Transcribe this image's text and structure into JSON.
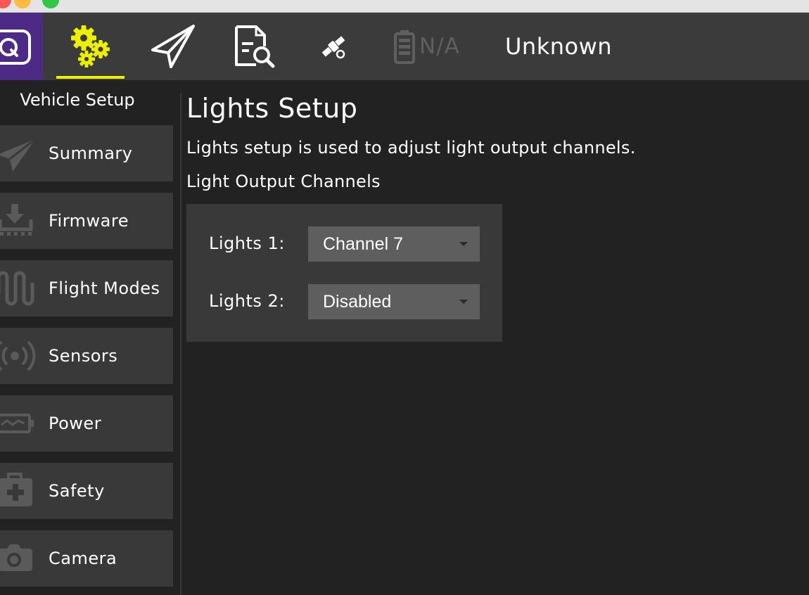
{
  "toolbar": {
    "battery_text": "N/A",
    "vehicle_status": "Unknown",
    "active_color": "#ecf000",
    "brand_color": "#4c2a86"
  },
  "icons": {
    "app_logo": "qgc-logo-icon",
    "vehicle_setup": "gears-icon",
    "plan": "paper-plane-icon",
    "analyze": "document-search-icon",
    "gps": "satellite-icon",
    "battery": "battery-icon"
  },
  "sidebar": {
    "header": "Vehicle Setup",
    "items": [
      {
        "label": "Summary",
        "icon": "paper-plane-icon"
      },
      {
        "label": "Firmware",
        "icon": "download-icon"
      },
      {
        "label": "Flight Modes",
        "icon": "waveform-icon"
      },
      {
        "label": "Sensors",
        "icon": "radio-signal-icon"
      },
      {
        "label": "Power",
        "icon": "power-battery-icon"
      },
      {
        "label": "Safety",
        "icon": "first-aid-icon"
      },
      {
        "label": "Camera",
        "icon": "camera-icon"
      }
    ]
  },
  "main": {
    "title": "Lights Setup",
    "description": "Lights setup is used to adjust light output channels.",
    "section_title": "Light Output Channels",
    "rows": [
      {
        "label": "Lights 1:",
        "value": "Channel 7"
      },
      {
        "label": "Lights 2:",
        "value": "Disabled"
      }
    ]
  }
}
